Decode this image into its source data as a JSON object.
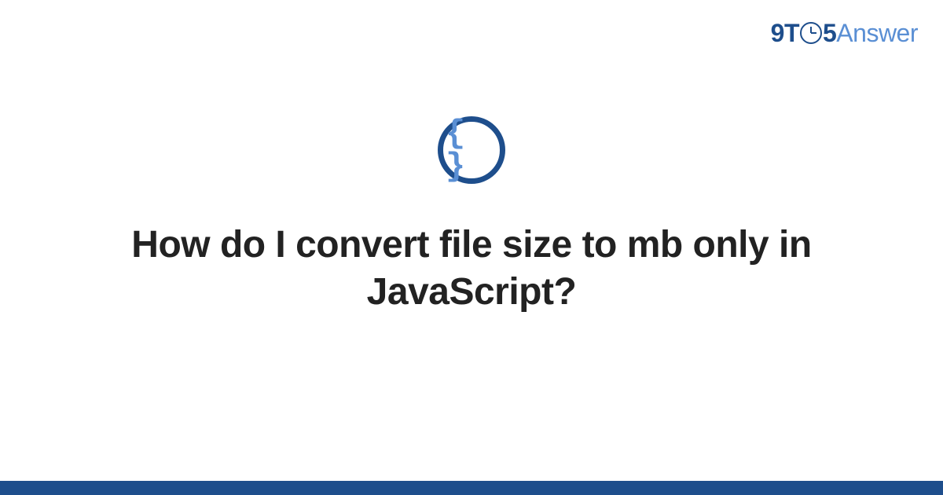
{
  "brand": {
    "part1": "9T",
    "part2": "5",
    "part3": "Answer"
  },
  "category_icon": {
    "name": "code-braces-icon",
    "glyph": "{ }"
  },
  "title": "How do I convert file size to mb only in JavaScript?",
  "colors": {
    "primary": "#1e4e8c",
    "secondary": "#5a8fd4",
    "text": "#222222",
    "background": "#ffffff"
  }
}
